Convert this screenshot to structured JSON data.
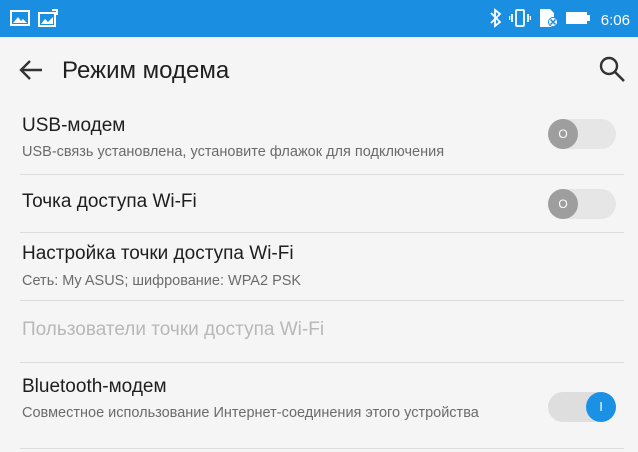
{
  "status_bar": {
    "time": "6:06",
    "background_color": "#1a8ee0",
    "left_icons": [
      "image-notification-icon",
      "photo-upload-icon"
    ],
    "right_icons": [
      "bluetooth-icon",
      "vibrate-icon",
      "no-sim-icon",
      "battery-icon"
    ]
  },
  "toolbar": {
    "title": "Режим модема",
    "back_icon": "arrow-left-icon",
    "search_icon": "search-icon"
  },
  "settings": [
    {
      "title": "USB-модем",
      "subtitle": "USB-связь установлена, установите флажок для подключения",
      "toggle": {
        "state": "off",
        "thumb_label": "O"
      }
    },
    {
      "title": "Точка доступа Wi-Fi",
      "toggle": {
        "state": "off",
        "thumb_label": "O"
      }
    },
    {
      "title": "Настройка точки доступа Wi-Fi",
      "subtitle": "Сеть: My ASUS; шифрование: WPA2 PSK"
    },
    {
      "title": "Пользователи точки доступа Wi-Fi",
      "disabled": true
    },
    {
      "title": "Bluetooth-модем",
      "subtitle": "Совместное использование Интернет-соединения этого устройства",
      "toggle": {
        "state": "on",
        "thumb_label": "I"
      }
    }
  ],
  "colors": {
    "accent": "#1b91e6",
    "background": "#f5f5f5",
    "disabled_text": "#b8b8b8"
  }
}
